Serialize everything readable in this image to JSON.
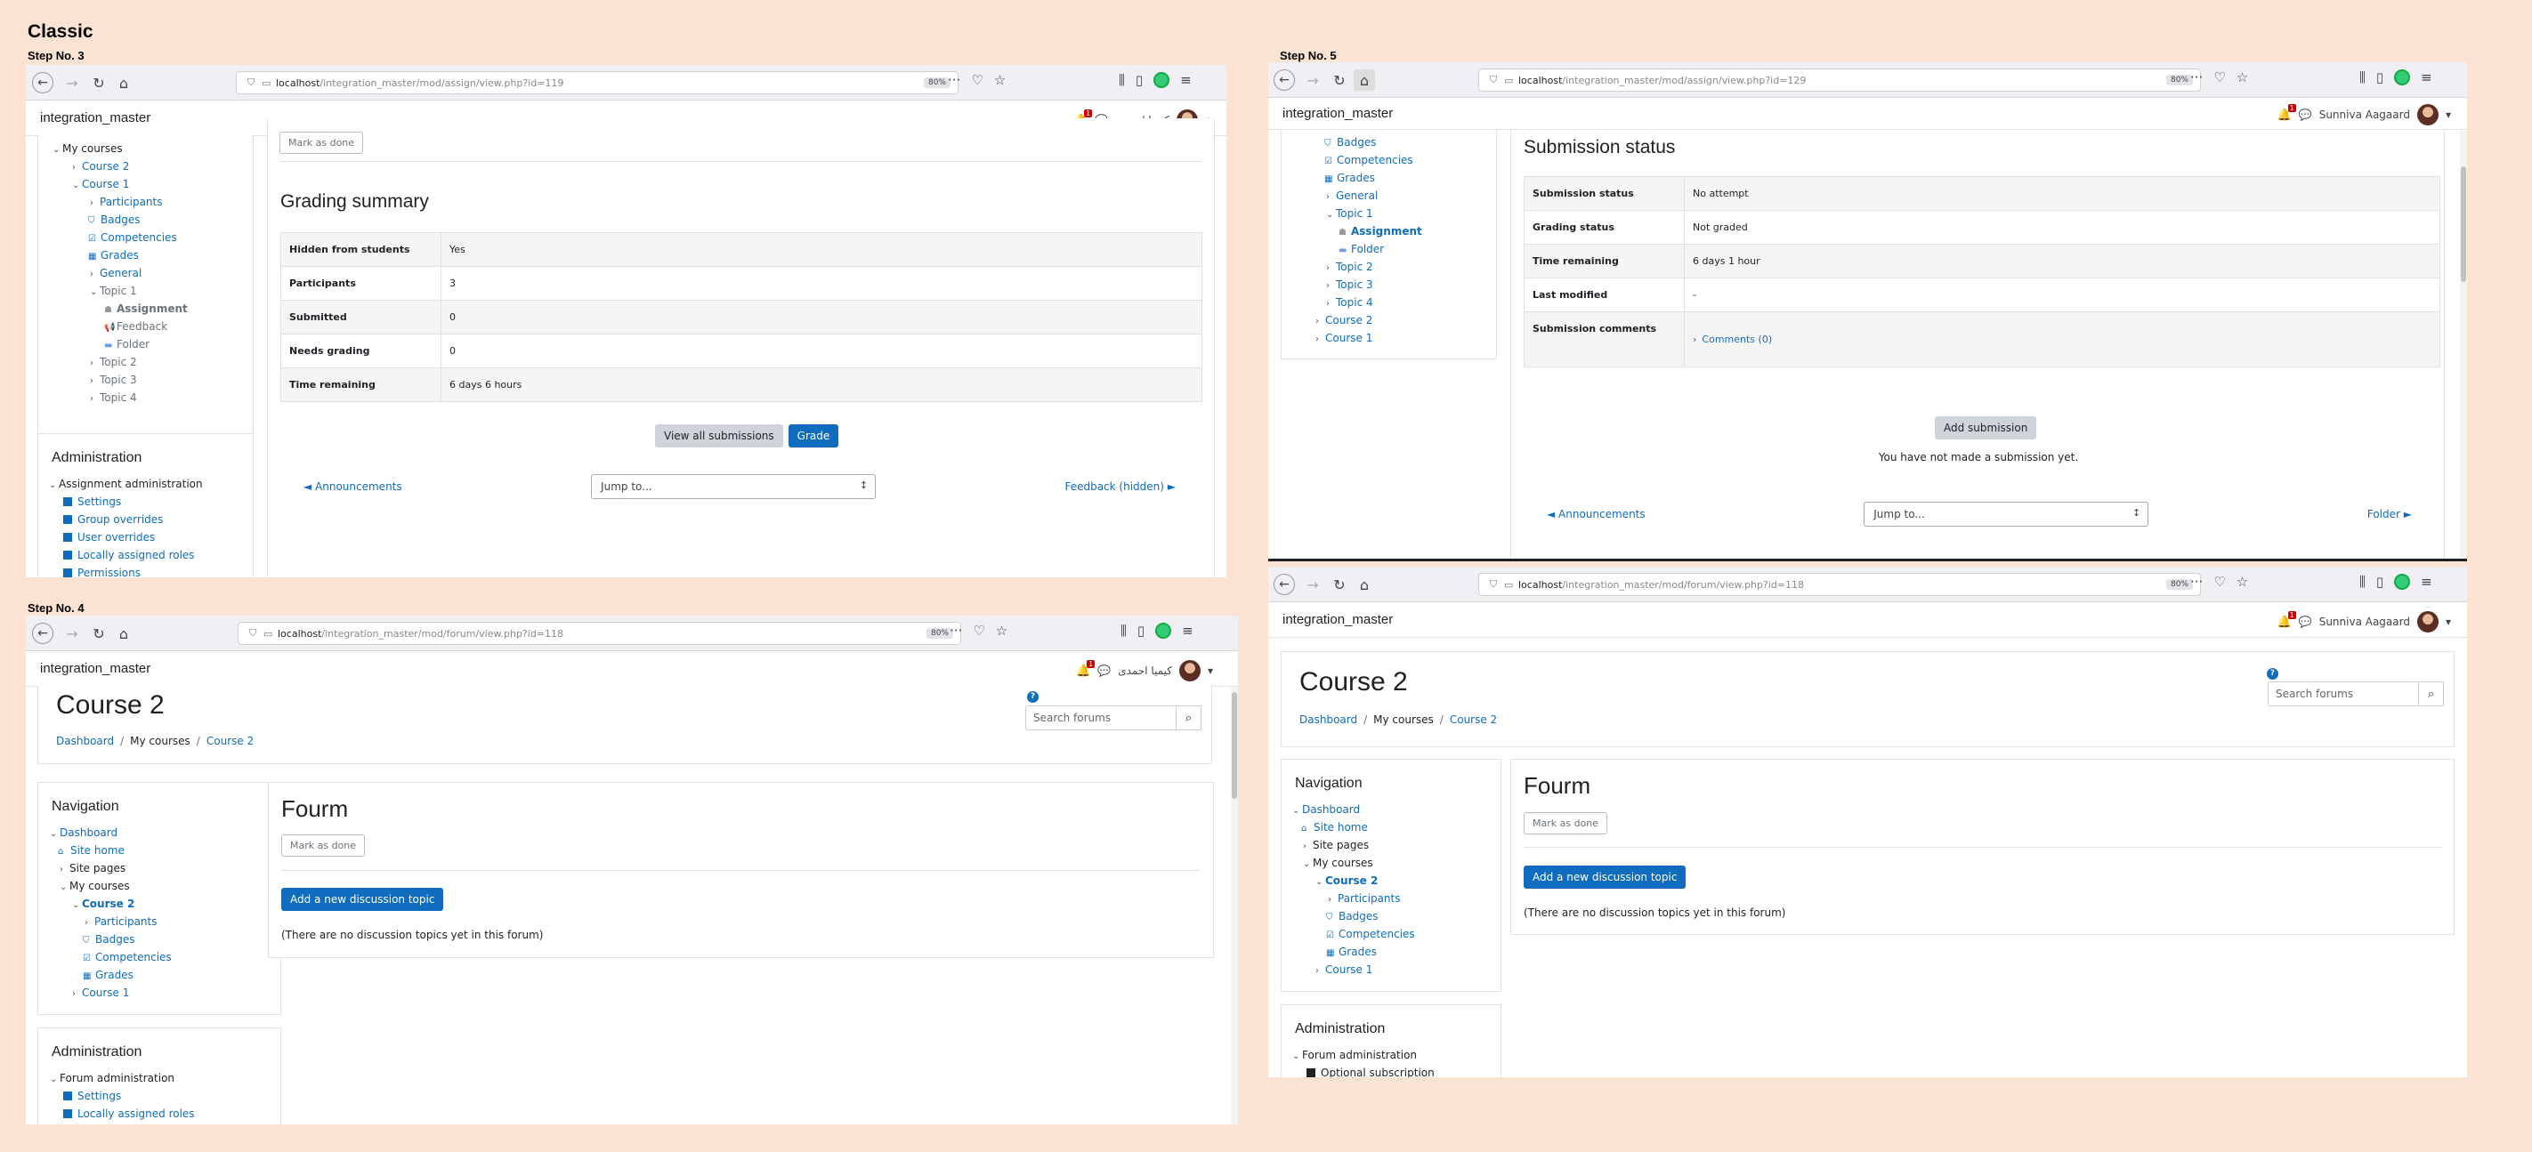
{
  "page_title": "Classic",
  "steps": {
    "s3": "Step No. 3",
    "s4": "Step No. 4",
    "s5": "Step No. 5"
  },
  "site": "integration_master",
  "zoom": "80%",
  "url_host": "localhost",
  "users": {
    "arabic": "کیمیا احمدی",
    "sunniva": "Sunniva Aagaard"
  },
  "p3": {
    "url_path": "/integration_master/mod/assign/view.php?id=119",
    "mark_done": "Mark as done",
    "heading": "Grading summary",
    "rows": [
      {
        "k": "Hidden from students",
        "v": "Yes"
      },
      {
        "k": "Participants",
        "v": "3"
      },
      {
        "k": "Submitted",
        "v": "0"
      },
      {
        "k": "Needs grading",
        "v": "0"
      },
      {
        "k": "Time remaining",
        "v": "6 days 6 hours"
      }
    ],
    "view_all": "View all submissions",
    "grade": "Grade",
    "prev": "◄ Announcements",
    "jump": "Jump to...",
    "next": "Feedback (hidden) ►",
    "nav": [
      "My courses",
      "Course 2",
      "Course 1",
      "Participants",
      "Badges",
      "Competencies",
      "Grades",
      "General",
      "Topic 1",
      "Assignment",
      "Feedback",
      "Folder",
      "Topic 2",
      "Topic 3",
      "Topic 4"
    ],
    "admin_title": "Administration",
    "admin_sub": "Assignment administration",
    "admin_items": [
      "Settings",
      "Group overrides",
      "User overrides",
      "Locally assigned roles",
      "Permissions"
    ]
  },
  "p4": {
    "url_path": "/integration_master/mod/forum/view.php?id=118",
    "course": "Course 2",
    "search_placeholder": "Search forums",
    "crumbs": [
      "Dashboard",
      "My courses",
      "Course 2"
    ],
    "nav_title": "Navigation",
    "nav": [
      "Dashboard",
      "Site home",
      "Site pages",
      "My courses",
      "Course 2",
      "Participants",
      "Badges",
      "Competencies",
      "Grades",
      "Course 1"
    ],
    "forum_title": "Fourm",
    "mark_done": "Mark as done",
    "add_topic": "Add a new discussion topic",
    "empty": "(There are no discussion topics yet in this forum)",
    "admin_title": "Administration",
    "admin_sub": "Forum administration",
    "admin_items": [
      "Settings",
      "Locally assigned roles"
    ]
  },
  "p5": {
    "url_path": "/integration_master/mod/assign/view.php?id=129",
    "heading": "Submission status",
    "rows": [
      {
        "k": "Submission status",
        "v": "No attempt"
      },
      {
        "k": "Grading status",
        "v": "Not graded"
      },
      {
        "k": "Time remaining",
        "v": "6 days 1 hour"
      },
      {
        "k": "Last modified",
        "v": "-"
      },
      {
        "k": "Submission comments",
        "v": "Comments (0)"
      }
    ],
    "add_submission": "Add submission",
    "not_made": "You have not made a submission yet.",
    "prev": "◄ Announcements",
    "jump": "Jump to...",
    "next": "Folder ►",
    "nav": [
      "Badges",
      "Competencies",
      "Grades",
      "General",
      "Topic 1",
      "Assignment",
      "Folder",
      "Topic 2",
      "Topic 3",
      "Topic 4",
      "Course 2",
      "Course 1"
    ]
  },
  "p6": {
    "url_path": "/integration_master/mod/forum/view.php?id=118",
    "course": "Course 2",
    "search_placeholder": "Search forums",
    "crumbs": [
      "Dashboard",
      "My courses",
      "Course 2"
    ],
    "nav_title": "Navigation",
    "nav": [
      "Dashboard",
      "Site home",
      "Site pages",
      "My courses",
      "Course 2",
      "Participants",
      "Badges",
      "Competencies",
      "Grades",
      "Course 1"
    ],
    "forum_title": "Fourm",
    "mark_done": "Mark as done",
    "add_topic": "Add a new discussion topic",
    "empty": "(There are no discussion topics yet in this forum)",
    "admin_title": "Administration",
    "admin_sub": "Forum administration",
    "admin_items": [
      "Optional subscription"
    ]
  }
}
